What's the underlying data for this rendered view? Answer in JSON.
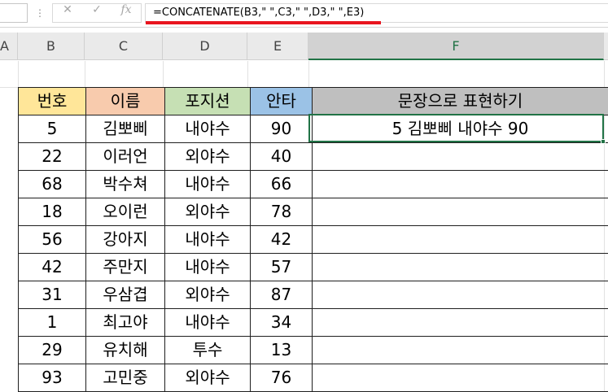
{
  "formula_bar": {
    "cancel_glyph": "✕",
    "enter_glyph": "✓",
    "fx_glyph": "fx",
    "formula": "=CONCATENATE(B3,\" \",C3,\" \",D3,\" \",E3)"
  },
  "columns": [
    "A",
    "B",
    "C",
    "D",
    "E",
    "F"
  ],
  "header": {
    "number": "번호",
    "name": "이름",
    "position": "포지션",
    "hits": "안타",
    "sentence": "문장으로 표현하기"
  },
  "header_colors": {
    "number": "#ffe699",
    "name": "#f8cbad",
    "position": "#c6e0b4",
    "hits": "#9bc2e6",
    "sentence": "#bfbfbf"
  },
  "accent": "#217346",
  "rows": [
    {
      "number": "5",
      "name": "김뽀삐",
      "position": "내야수",
      "hits": "90",
      "sentence": "5 김뽀삐 내야수 90"
    },
    {
      "number": "22",
      "name": "이러언",
      "position": "외야수",
      "hits": "40",
      "sentence": ""
    },
    {
      "number": "68",
      "name": "박수쳐",
      "position": "내야수",
      "hits": "66",
      "sentence": ""
    },
    {
      "number": "18",
      "name": "오이런",
      "position": "외야수",
      "hits": "78",
      "sentence": ""
    },
    {
      "number": "56",
      "name": "강아지",
      "position": "내야수",
      "hits": "42",
      "sentence": ""
    },
    {
      "number": "42",
      "name": "주만지",
      "position": "내야수",
      "hits": "57",
      "sentence": ""
    },
    {
      "number": "31",
      "name": "우삼겹",
      "position": "외야수",
      "hits": "87",
      "sentence": ""
    },
    {
      "number": "1",
      "name": "최고야",
      "position": "내야수",
      "hits": "34",
      "sentence": ""
    },
    {
      "number": "29",
      "name": "유치해",
      "position": "투수",
      "hits": "13",
      "sentence": ""
    },
    {
      "number": "93",
      "name": "고민중",
      "position": "외야수",
      "hits": "76",
      "sentence": ""
    }
  ]
}
